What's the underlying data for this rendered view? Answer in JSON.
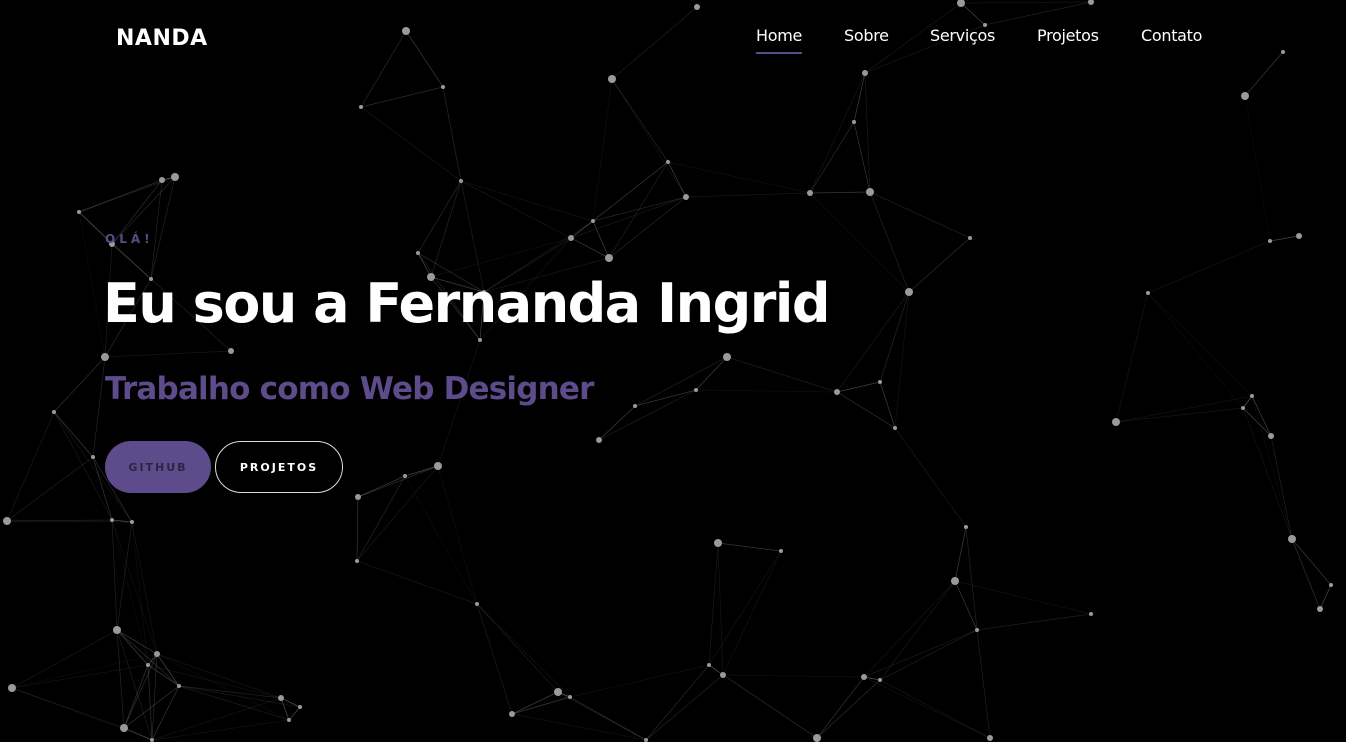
{
  "header": {
    "logo": "NANDA",
    "nav": [
      {
        "label": "Home",
        "active": true
      },
      {
        "label": "Sobre",
        "active": false
      },
      {
        "label": "Serviços",
        "active": false
      },
      {
        "label": "Projetos",
        "active": false
      },
      {
        "label": "Contato",
        "active": false
      }
    ]
  },
  "hero": {
    "greeting": "OLÁ!",
    "title": "Eu sou a Fernanda Ingrid",
    "subtitle": "Trabalho como Web Designer",
    "buttons": {
      "github": "GITHUB",
      "projetos": "PROJETOS"
    }
  },
  "colors": {
    "background": "#000000",
    "accent": "#5e4b8b",
    "text": "#ffffff"
  }
}
